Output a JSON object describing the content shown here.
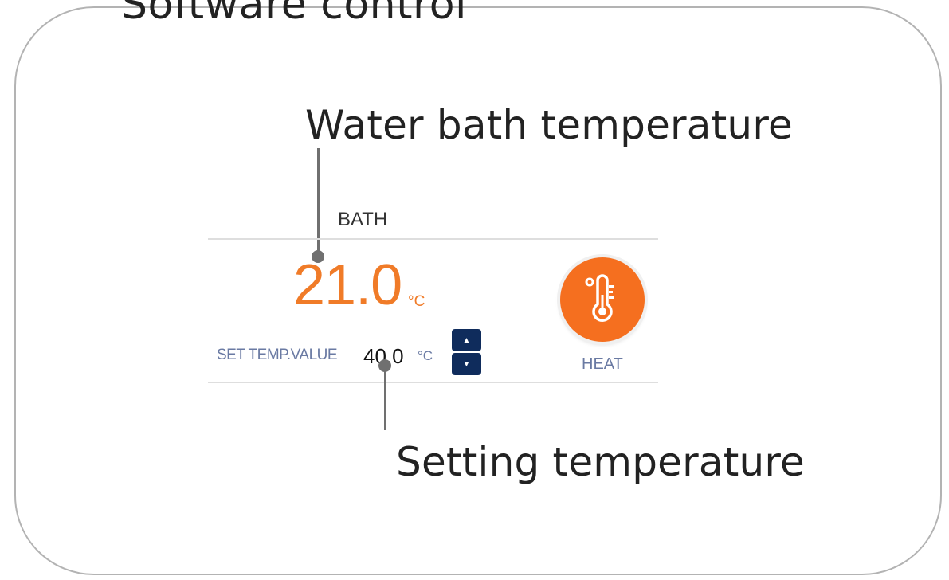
{
  "frame": {
    "title": "Software control"
  },
  "callouts": {
    "water_bath": "Water bath temperature",
    "setting": "Setting temperature"
  },
  "panel": {
    "label": "BATH",
    "current_temp": "21.0",
    "current_unit": "°C",
    "set_label": "SET TEMP.VALUE",
    "set_value": "40.0",
    "set_unit": "°C",
    "heat_label": "HEAT"
  },
  "icons": {
    "stepper_up": "chevron-up-icon",
    "stepper_down": "chevron-down-icon",
    "heat": "thermometer-icon"
  },
  "colors": {
    "accent_orange": "#f07b28",
    "heat_button": "#f56f1f",
    "stepper_navy": "#0f2c5c",
    "label_blue": "#6a7aa3"
  }
}
